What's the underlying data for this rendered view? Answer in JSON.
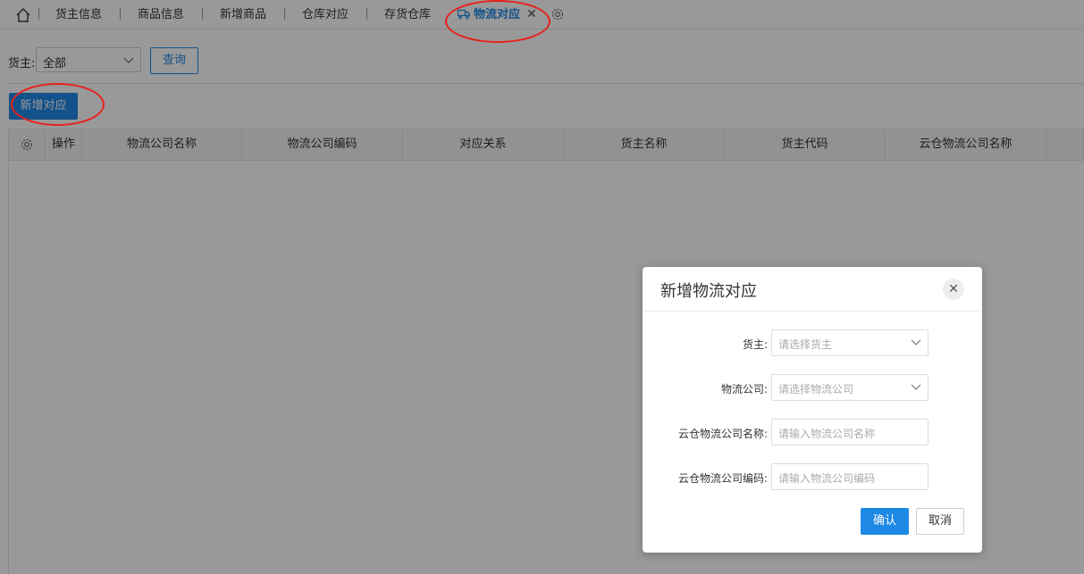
{
  "tabs": [
    {
      "label": "货主信息"
    },
    {
      "label": "商品信息"
    },
    {
      "label": "新增商品"
    },
    {
      "label": "仓库对应"
    },
    {
      "label": "存货仓库"
    },
    {
      "label": "物流对应",
      "active": true
    }
  ],
  "close_glyph": "✕",
  "icons": {
    "home": "home-icon",
    "truck": "truck-icon",
    "close": "close-icon",
    "settings": "gear-icon",
    "dropdown": "chevron-down-icon"
  },
  "filter": {
    "owner_label": "货主:",
    "owner_value": "全部",
    "query_label": "查询"
  },
  "toolbar": {
    "add_label": "新增对应"
  },
  "grid": {
    "columns": [
      "操作",
      "物流公司名称",
      "物流公司编码",
      "对应关系",
      "货主名称",
      "货主代码",
      "云仓物流公司名称"
    ]
  },
  "dialog": {
    "title": "新增物流对应",
    "close": "✕",
    "fields": [
      {
        "label": "货主:",
        "placeholder": "请选择货主",
        "type": "select"
      },
      {
        "label": "物流公司:",
        "placeholder": "请选择物流公司",
        "type": "select"
      },
      {
        "label": "云仓物流公司名称:",
        "placeholder": "请输入物流公司名称",
        "type": "input"
      },
      {
        "label": "云仓物流公司编码:",
        "placeholder": "请输入物流公司编码",
        "type": "input"
      }
    ],
    "confirm_label": "确认",
    "cancel_label": "取消"
  },
  "colors": {
    "accent": "#1e88e5",
    "annotation": "#e8211b",
    "mask": "rgba(0,0,0,0.4)"
  }
}
